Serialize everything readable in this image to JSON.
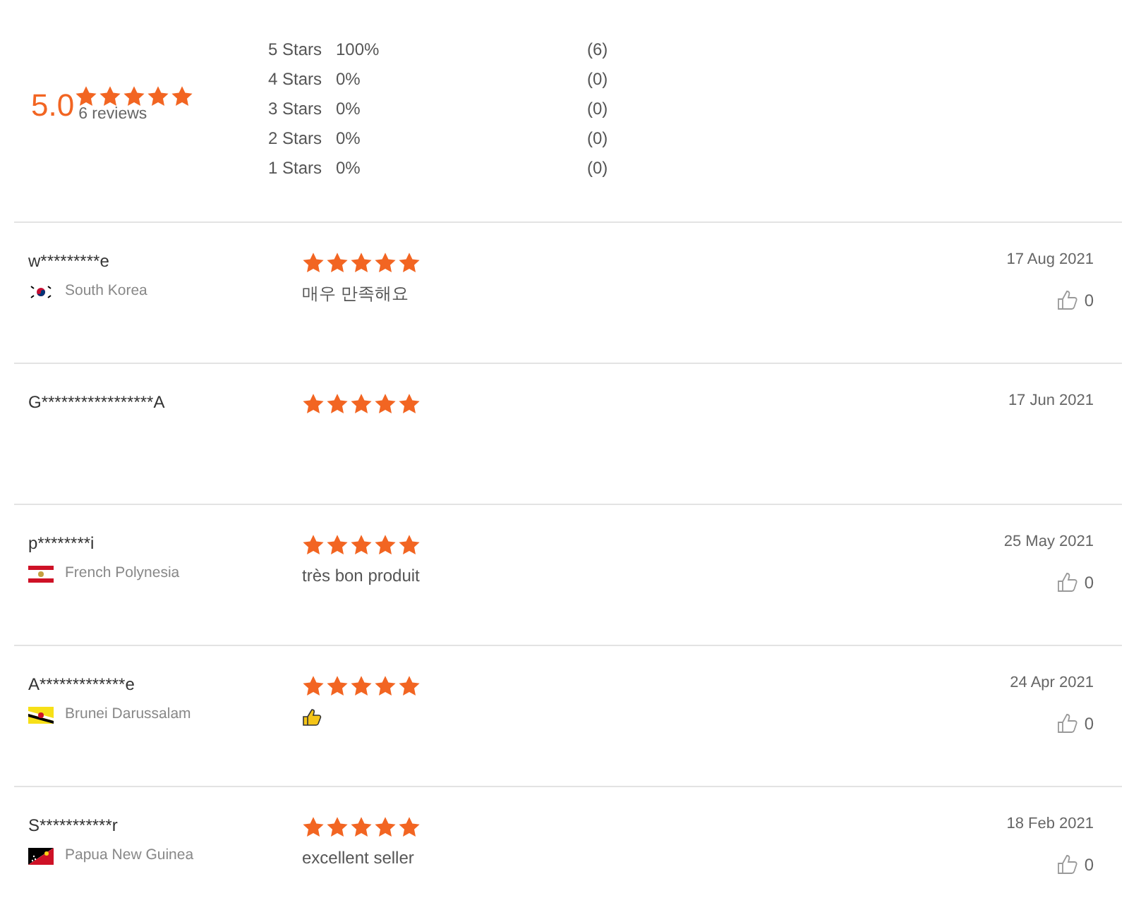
{
  "summary": {
    "score": "5.0",
    "stars": 5,
    "count": "6 reviews"
  },
  "distribution": [
    {
      "stars": "5",
      "label": "Stars",
      "percent": "100%",
      "count": "(6)"
    },
    {
      "stars": "4",
      "label": "Stars",
      "percent": "0%",
      "count": "(0)"
    },
    {
      "stars": "3",
      "label": "Stars",
      "percent": "0%",
      "count": "(0)"
    },
    {
      "stars": "2",
      "label": "Stars",
      "percent": "0%",
      "count": "(0)"
    },
    {
      "stars": "1",
      "label": "Stars",
      "percent": "0%",
      "count": "(0)"
    }
  ],
  "reviews": [
    {
      "user": "w*********e",
      "country": "South Korea",
      "stars": 5,
      "comment": {
        "kind": "text",
        "text": "매우 만족해요"
      },
      "date": "17 Aug 2021",
      "likes": "0"
    },
    {
      "user": "G*****************A",
      "stars": 5,
      "date": "17 Jun 2021"
    },
    {
      "user": "p********i",
      "country": "French Polynesia",
      "stars": 5,
      "comment": {
        "kind": "text",
        "text": "très bon produit"
      },
      "date": "25 May 2021",
      "likes": "0"
    },
    {
      "user": "A*************e",
      "country": "Brunei Darussalam",
      "stars": 5,
      "comment": {
        "kind": "thumbs"
      },
      "date": "24 Apr 2021",
      "likes": "0"
    },
    {
      "user": "S***********r",
      "country": "Papua New Guinea",
      "stars": 5,
      "comment": {
        "kind": "text",
        "text": "excellent seller"
      },
      "date": "18 Feb 2021",
      "likes": "0"
    }
  ]
}
